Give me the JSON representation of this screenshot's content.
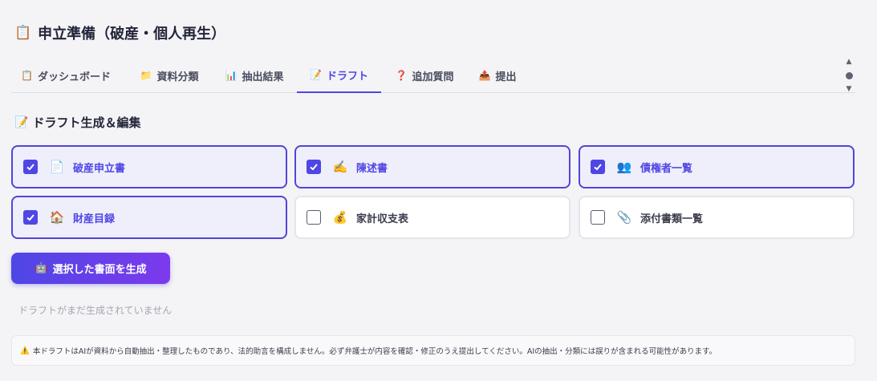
{
  "page": {
    "title_icon": "clipboard-icon",
    "title": "申立準備（破産・個人再生）"
  },
  "tabs": [
    {
      "icon": "📋",
      "icon_name": "clipboard-icon",
      "label": "ダッシュボード",
      "active": false
    },
    {
      "icon": "📁",
      "icon_name": "folder-icon",
      "label": "資料分類",
      "active": false
    },
    {
      "icon": "📊",
      "icon_name": "bar-chart-icon",
      "label": "抽出結果",
      "active": false
    },
    {
      "icon": "📝",
      "icon_name": "memo-icon",
      "label": "ドラフト",
      "active": true
    },
    {
      "icon": "❓",
      "icon_name": "question-icon",
      "label": "追加質問",
      "active": false
    },
    {
      "icon": "📤",
      "icon_name": "outbox-icon",
      "label": "提出",
      "active": false
    }
  ],
  "section": {
    "icon": "📝",
    "title": "ドラフト生成＆編集"
  },
  "documents": [
    {
      "icon": "📄",
      "icon_name": "document-icon",
      "label": "破産申立書",
      "checked": true
    },
    {
      "icon": "✍️",
      "icon_name": "writing-hand-icon",
      "label": "陳述書",
      "checked": true
    },
    {
      "icon": "👥",
      "icon_name": "people-icon",
      "label": "債権者一覧",
      "checked": true
    },
    {
      "icon": "🏠",
      "icon_name": "house-icon",
      "label": "財産目録",
      "checked": true
    },
    {
      "icon": "💰",
      "icon_name": "money-bag-icon",
      "label": "家計収支表",
      "checked": false
    },
    {
      "icon": "📎",
      "icon_name": "paperclip-icon",
      "label": "添付書類一覧",
      "checked": false
    }
  ],
  "generate_button": {
    "icon": "🤖",
    "icon_name": "robot-icon",
    "label": "選択した書面を生成"
  },
  "empty_message": "ドラフトがまだ生成されていません",
  "disclaimer": {
    "icon": "⚠️",
    "icon_name": "warning-icon",
    "text": "本ドラフトはAIが資料から自動抽出・整理したものであり、法的助言を構成しません。必ず弁護士が内容を確認・修正のうえ提出してください。AIの抽出・分類には誤りが含まれる可能性があります。"
  },
  "colors": {
    "accent": "#4f46e5",
    "accent_gradient_end": "#7c3aed",
    "checked_card_bg": "#efeefb"
  }
}
